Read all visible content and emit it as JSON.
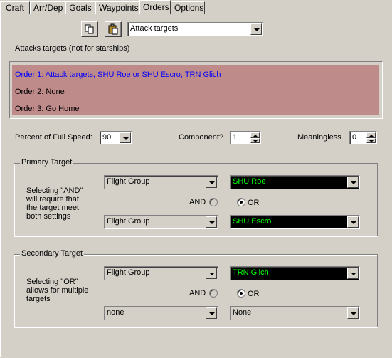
{
  "tabs": [
    "Craft",
    "Arr/Dep",
    "Goals",
    "Waypoints",
    "Orders",
    "Options"
  ],
  "toolbar": {
    "copy_icon": "copy-icon",
    "paste_icon": "paste-icon",
    "order_type": "Attack targets"
  },
  "description": "Attacks targets (not for starships)",
  "orders": [
    "Order 1: Attack targets, SHU Roe or SHU Escro, TRN Glich",
    "Order 2: None",
    "Order 3: Go Home"
  ],
  "settings": {
    "speed_label": "Percent of Full Speed:",
    "speed_value": "90",
    "component_label": "Component?",
    "component_value": "1",
    "meaningless_label": "Meaningless",
    "meaningless_value": "0"
  },
  "primary": {
    "title": "Primary Target",
    "hint": [
      "Selecting \"AND\"",
      "will require that",
      "the target meet",
      "both settings"
    ],
    "type1": "Flight Group",
    "target1": "SHU Roe",
    "type2": "Flight Group",
    "target2": "SHU Escro",
    "and_label": "AND",
    "or_label": "OR",
    "selected": "OR"
  },
  "secondary": {
    "title": "Secondary Target",
    "hint": [
      "Selecting \"OR\"",
      "allows for multiple",
      "targets"
    ],
    "type1": "Flight Group",
    "target1": "TRN Glich",
    "type2": "none",
    "target2": "None",
    "and_label": "AND",
    "or_label": "OR",
    "selected": "OR"
  },
  "colors": {
    "order_highlight": "#0000ff",
    "orders_bg": "#bf8a8a",
    "target_text": "#00ff00"
  }
}
